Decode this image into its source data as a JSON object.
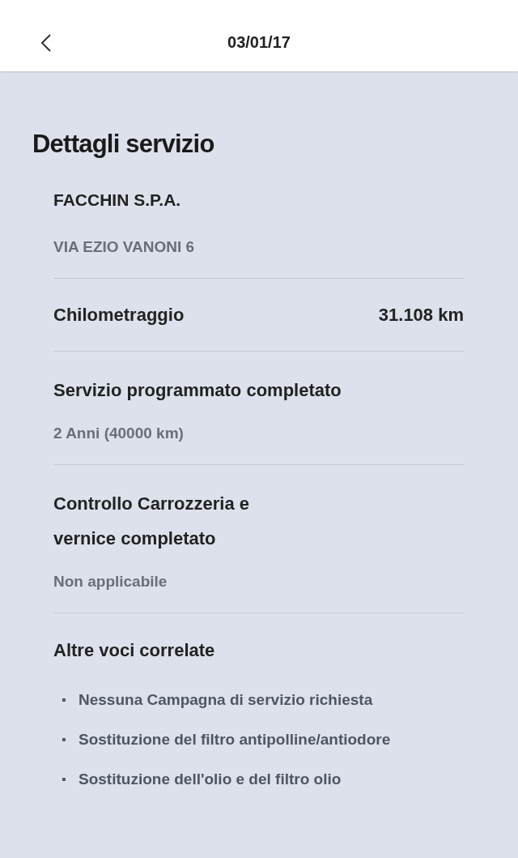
{
  "header": {
    "title": "03/01/17"
  },
  "section": {
    "title": "Dettagli servizio",
    "dealer": {
      "name": "FACCHIN S.P.A.",
      "address": "VIA EZIO VANONI 6"
    },
    "rows": [
      {
        "kind": "pair",
        "label": "Chilometraggio",
        "value": "31.108 km"
      },
      {
        "kind": "stacked",
        "label_lines": [
          "Servizio programmato completato"
        ],
        "value": "2 Anni (40000 km)"
      },
      {
        "kind": "stacked",
        "label_lines": [
          "Controllo Carrozzeria e",
          "vernice completato"
        ],
        "value": "Non applicabile"
      }
    ],
    "related": {
      "title": "Altre voci correlate",
      "items": [
        "Nessuna Campagna di servizio richiesta",
        "Sostituzione del filtro antipolline/antiodore",
        "Sostituzione dell'olio e del filtro olio"
      ]
    }
  }
}
